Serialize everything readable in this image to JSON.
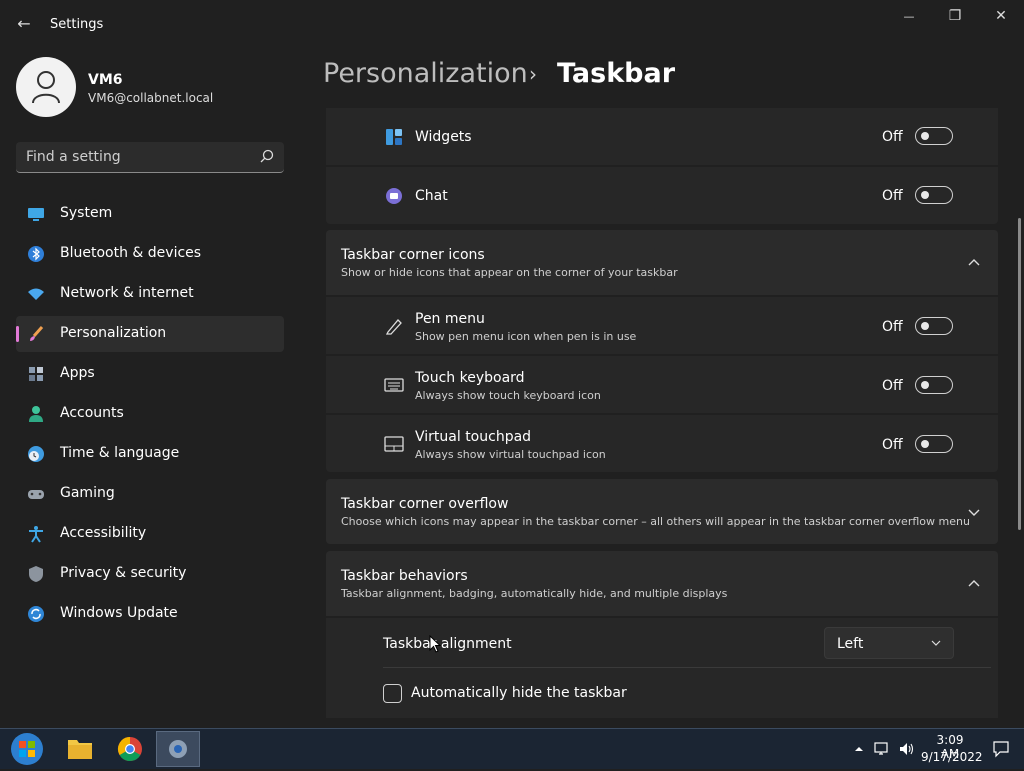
{
  "window": {
    "title": "Settings",
    "controls": {
      "minimize": "—",
      "maximize": "❐",
      "close": "✕"
    }
  },
  "user": {
    "name": "VM6",
    "email": "VM6@collabnet.local"
  },
  "search": {
    "placeholder": "Find a setting"
  },
  "sidebar": {
    "items": [
      {
        "label": "System",
        "icon": "monitor-icon"
      },
      {
        "label": "Bluetooth & devices",
        "icon": "bluetooth-icon"
      },
      {
        "label": "Network & internet",
        "icon": "wifi-icon"
      },
      {
        "label": "Personalization",
        "icon": "brush-icon",
        "active": true
      },
      {
        "label": "Apps",
        "icon": "apps-icon"
      },
      {
        "label": "Accounts",
        "icon": "person-icon"
      },
      {
        "label": "Time & language",
        "icon": "globe-clock-icon"
      },
      {
        "label": "Gaming",
        "icon": "gamepad-icon"
      },
      {
        "label": "Accessibility",
        "icon": "accessibility-icon"
      },
      {
        "label": "Privacy & security",
        "icon": "shield-icon"
      },
      {
        "label": "Windows Update",
        "icon": "update-icon"
      }
    ]
  },
  "breadcrumb": {
    "parent": "Personalization",
    "separator": "›",
    "current": "Taskbar"
  },
  "taskbar_items": {
    "widgets": {
      "label": "Widgets",
      "state": "Off"
    },
    "chat": {
      "label": "Chat",
      "state": "Off"
    }
  },
  "corner_icons": {
    "title": "Taskbar corner icons",
    "description": "Show or hide icons that appear on the corner of your taskbar",
    "items": [
      {
        "label": "Pen menu",
        "description": "Show pen menu icon when pen is in use",
        "state": "Off"
      },
      {
        "label": "Touch keyboard",
        "description": "Always show touch keyboard icon",
        "state": "Off"
      },
      {
        "label": "Virtual touchpad",
        "description": "Always show virtual touchpad icon",
        "state": "Off"
      }
    ]
  },
  "corner_overflow": {
    "title": "Taskbar corner overflow",
    "description": "Choose which icons may appear in the taskbar corner – all others will appear in the taskbar corner overflow menu"
  },
  "behaviors": {
    "title": "Taskbar behaviors",
    "description": "Taskbar alignment, badging, automatically hide, and multiple displays",
    "alignment_label": "Taskbar alignment",
    "alignment_value": "Left",
    "autohide_label": "Automatically hide the taskbar"
  },
  "clock": {
    "time": "3:09 AM",
    "date": "9/17/2022"
  },
  "colors": {
    "accent": "#e27ad7",
    "background": "#202020",
    "card": "#2b2b2b",
    "taskbar": "#1b2533"
  }
}
